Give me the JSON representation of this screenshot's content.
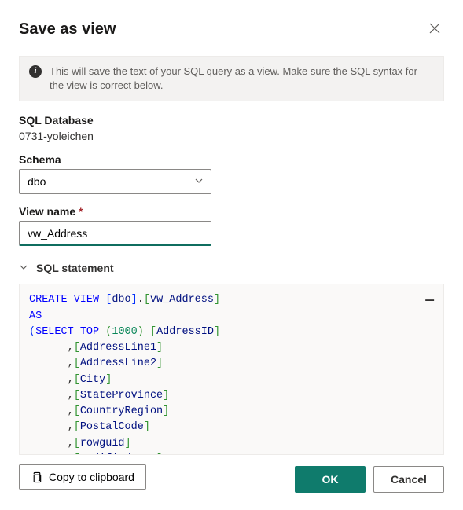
{
  "dialog": {
    "title": "Save as view",
    "info_text": "This will save the text of your SQL query as a view. Make sure the SQL syntax for the view is correct below."
  },
  "fields": {
    "database_label": "SQL Database",
    "database_value": "0731-yoleichen",
    "schema_label": "Schema",
    "schema_value": "dbo",
    "viewname_label": "View name",
    "viewname_value": "vw_Address"
  },
  "sql_section": {
    "header": "SQL statement",
    "tokens": [
      {
        "t": "CREATE VIEW ",
        "c": "kw"
      },
      {
        "t": "[",
        "c": "br1"
      },
      {
        "t": "dbo",
        "c": "ident"
      },
      {
        "t": "]",
        "c": "br1"
      },
      {
        "t": ".",
        "c": ""
      },
      {
        "t": "[",
        "c": "br2"
      },
      {
        "t": "vw_Address",
        "c": "ident"
      },
      {
        "t": "]",
        "c": "br2"
      },
      {
        "t": "\n"
      },
      {
        "t": "AS",
        "c": "kw"
      },
      {
        "t": "\n"
      },
      {
        "t": "(",
        "c": "br1"
      },
      {
        "t": "SELECT TOP ",
        "c": "kw"
      },
      {
        "t": "(",
        "c": "br2"
      },
      {
        "t": "1000",
        "c": "num"
      },
      {
        "t": ") ",
        "c": "br2"
      },
      {
        "t": "[",
        "c": "br2"
      },
      {
        "t": "AddressID",
        "c": "ident"
      },
      {
        "t": "]",
        "c": "br2"
      },
      {
        "t": "\n"
      },
      {
        "t": "      ,"
      },
      {
        "t": "[",
        "c": "br2"
      },
      {
        "t": "AddressLine1",
        "c": "ident"
      },
      {
        "t": "]",
        "c": "br2"
      },
      {
        "t": "\n"
      },
      {
        "t": "      ,"
      },
      {
        "t": "[",
        "c": "br2"
      },
      {
        "t": "AddressLine2",
        "c": "ident"
      },
      {
        "t": "]",
        "c": "br2"
      },
      {
        "t": "\n"
      },
      {
        "t": "      ,"
      },
      {
        "t": "[",
        "c": "br2"
      },
      {
        "t": "City",
        "c": "ident"
      },
      {
        "t": "]",
        "c": "br2"
      },
      {
        "t": "\n"
      },
      {
        "t": "      ,"
      },
      {
        "t": "[",
        "c": "br2"
      },
      {
        "t": "StateProvince",
        "c": "ident"
      },
      {
        "t": "]",
        "c": "br2"
      },
      {
        "t": "\n"
      },
      {
        "t": "      ,"
      },
      {
        "t": "[",
        "c": "br2"
      },
      {
        "t": "CountryRegion",
        "c": "ident"
      },
      {
        "t": "]",
        "c": "br2"
      },
      {
        "t": "\n"
      },
      {
        "t": "      ,"
      },
      {
        "t": "[",
        "c": "br2"
      },
      {
        "t": "PostalCode",
        "c": "ident"
      },
      {
        "t": "]",
        "c": "br2"
      },
      {
        "t": "\n"
      },
      {
        "t": "      ,"
      },
      {
        "t": "[",
        "c": "br2"
      },
      {
        "t": "rowguid",
        "c": "ident"
      },
      {
        "t": "]",
        "c": "br2"
      },
      {
        "t": "\n"
      },
      {
        "t": "       "
      },
      {
        "t": "[",
        "c": "br2"
      },
      {
        "t": "ModifiedDate",
        "c": "ident"
      },
      {
        "t": "]",
        "c": "br2"
      }
    ]
  },
  "buttons": {
    "copy": "Copy to clipboard",
    "ok": "OK",
    "cancel": "Cancel"
  }
}
